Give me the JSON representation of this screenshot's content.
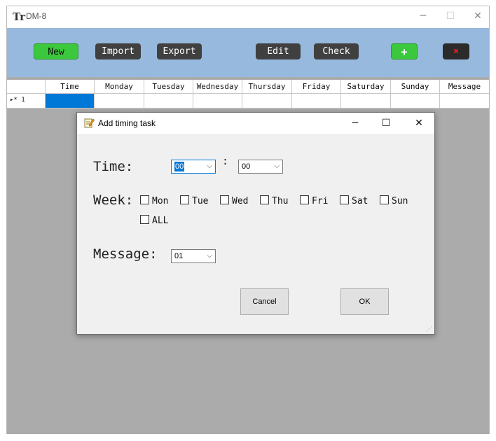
{
  "window": {
    "icon_glyph": "Tr",
    "title": "DM-8",
    "controls": {
      "minimize": "─",
      "maximize": "☐",
      "close": "✕"
    }
  },
  "toolbar": {
    "new_label": "New",
    "import_label": "Import",
    "export_label": "Export",
    "edit_label": "Edit",
    "check_label": "Check",
    "add_label": "+",
    "delete_label": "×"
  },
  "grid": {
    "columns": [
      "Time",
      "Monday",
      "Tuesday",
      "Wednesday",
      "Thursday",
      "Friday",
      "Saturday",
      "Sunday",
      "Message"
    ],
    "new_row_marker": "▸* 1"
  },
  "dialog": {
    "title": "Add timing task",
    "icon": "notepad-edit-icon",
    "controls": {
      "minimize": "─",
      "maximize": "☐",
      "close": "✕"
    },
    "time_label": "Time:",
    "hour_value": "00",
    "time_separator": ":",
    "minute_value": "00",
    "week_label": "Week:",
    "days": [
      "Mon",
      "Tue",
      "Wed",
      "Thu",
      "Fri",
      "Sat",
      "Sun"
    ],
    "all_label": "ALL",
    "message_label": "Message:",
    "message_value": "01",
    "cancel_label": "Cancel",
    "ok_label": "OK",
    "resize_grip": "⋰"
  },
  "colors": {
    "toolbar_bg": "#97b9dd",
    "green_button": "#3cc83c",
    "dark_button": "#404040",
    "grid_bg": "#ababab",
    "selection": "#0078d7"
  }
}
